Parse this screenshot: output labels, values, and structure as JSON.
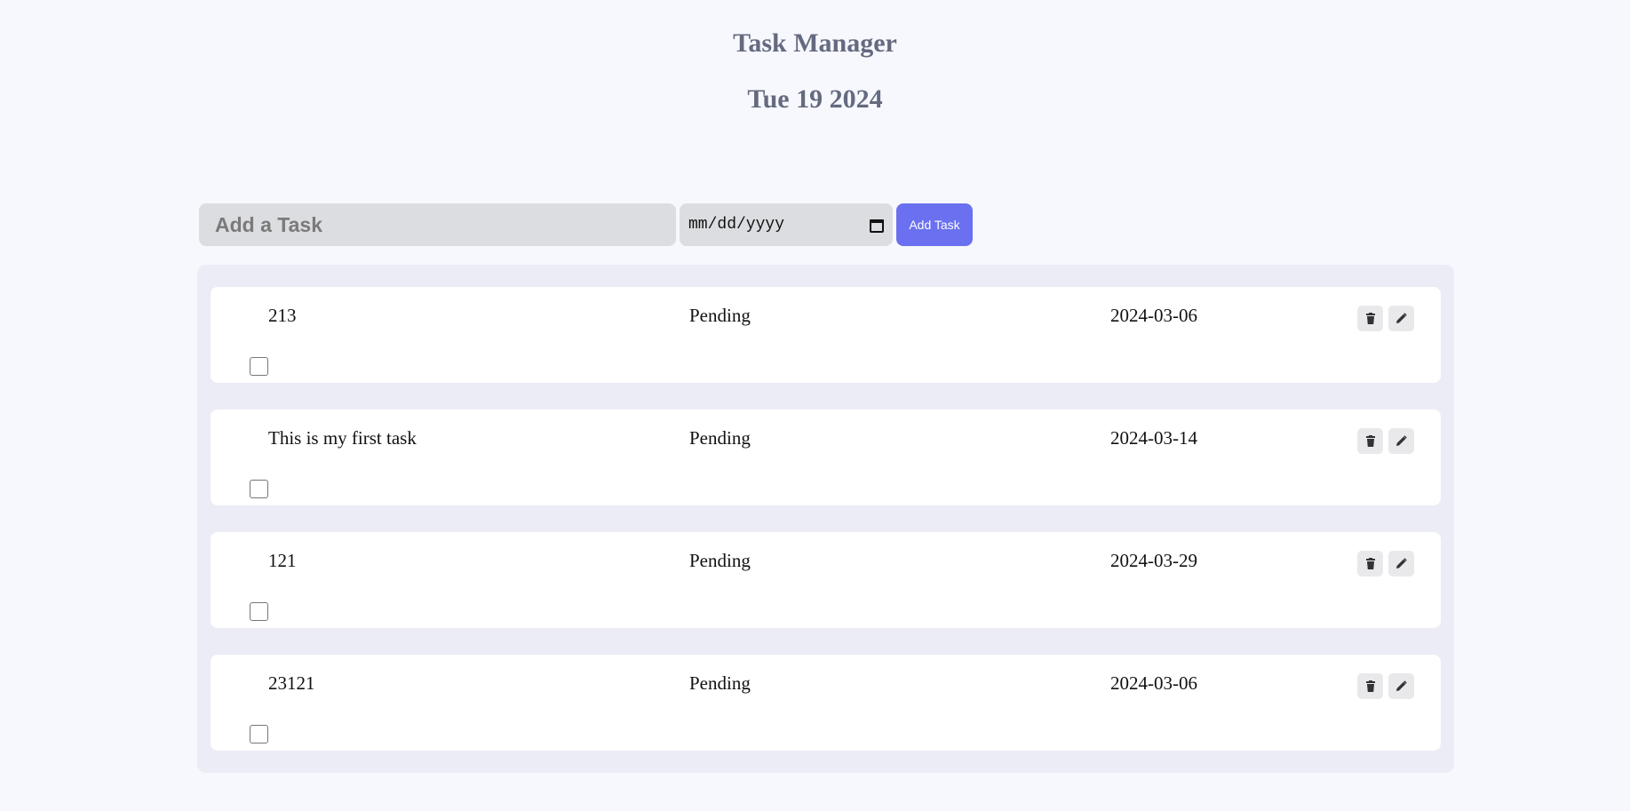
{
  "header": {
    "title": "Task Manager",
    "date": "Tue 19 2024"
  },
  "add_form": {
    "task_placeholder": "Add a Task",
    "date_placeholder": "mm/dd/yyyy",
    "add_button_label": "Add Task"
  },
  "tasks": [
    {
      "title": "213",
      "status": "Pending",
      "due": "2024-03-06",
      "completed": false
    },
    {
      "title": "This is my first task",
      "status": "Pending",
      "due": "2024-03-14",
      "completed": false
    },
    {
      "title": "121",
      "status": "Pending",
      "due": "2024-03-29",
      "completed": false
    },
    {
      "title": "23121",
      "status": "Pending",
      "due": "2024-03-06",
      "completed": false
    }
  ],
  "icons": {
    "delete": "trash-icon",
    "edit": "pencil-icon",
    "calendar": "calendar-icon"
  },
  "colors": {
    "accent": "#6a70f0",
    "heading": "#656a80",
    "background": "#f7f8fd",
    "panel": "#ebecf6"
  }
}
